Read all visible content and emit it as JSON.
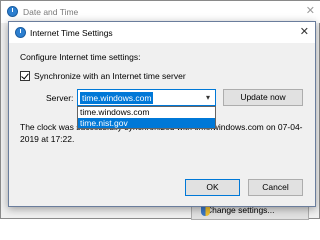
{
  "background_window": {
    "title": "Date and Time",
    "close_glyph": "✕",
    "change_button_label": "Change settings..."
  },
  "dialog": {
    "title": "Internet Time Settings",
    "close_glyph": "✕",
    "heading": "Configure Internet time settings:",
    "sync_checkbox": {
      "label": "Synchronize with an Internet time server",
      "checked": true
    },
    "server": {
      "label": "Server:",
      "selected_value": "time.windows.com",
      "options": [
        "time.windows.com",
        "time.nist.gov"
      ],
      "highlighted_option": "time.nist.gov"
    },
    "update_button_label": "Update now",
    "clock_message": "The clock was successfully synchronized with time.windows.com on 07-04-2019 at 17:22.",
    "ok_label": "OK",
    "cancel_label": "Cancel"
  },
  "colors": {
    "accent": "#0078d7",
    "button_face": "#e1e1e1",
    "window_bg": "#f0f0f0"
  },
  "icons": {
    "dialog_icon": "clock-icon",
    "dropdown_arrow": "chevron-down-icon",
    "close": "close-icon",
    "shield": "uac-shield-icon"
  }
}
